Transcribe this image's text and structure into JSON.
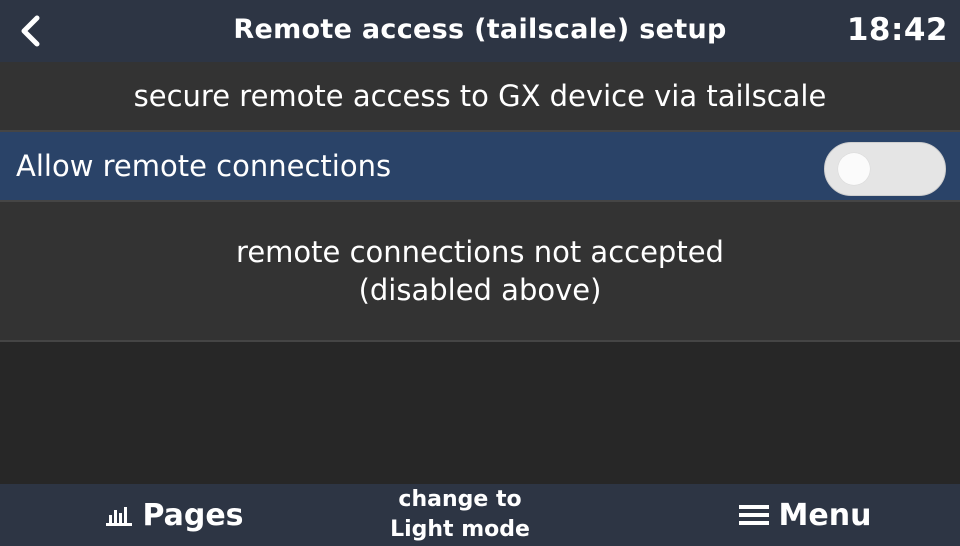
{
  "header": {
    "title": "Remote access (tailscale) setup",
    "clock": "18:42",
    "back_icon": "chevron-left-icon"
  },
  "description": "secure remote access to GX device via tailscale",
  "switch_row": {
    "label": "Allow remote connections",
    "enabled": false
  },
  "status": {
    "line1": "remote connections not accepted",
    "line2": "(disabled above)"
  },
  "footer": {
    "pages_label": "Pages",
    "pages_icon": "bar-chart-icon",
    "light_mode_line1": "change to",
    "light_mode_line2": "Light mode",
    "menu_label": "Menu",
    "menu_icon": "hamburger-menu-icon"
  },
  "colors": {
    "header_bg": "#2d3544",
    "content_bg": "#333333",
    "empty_bg": "#272727",
    "selected_row_bg": "#2a4368",
    "text": "#ffffff"
  }
}
